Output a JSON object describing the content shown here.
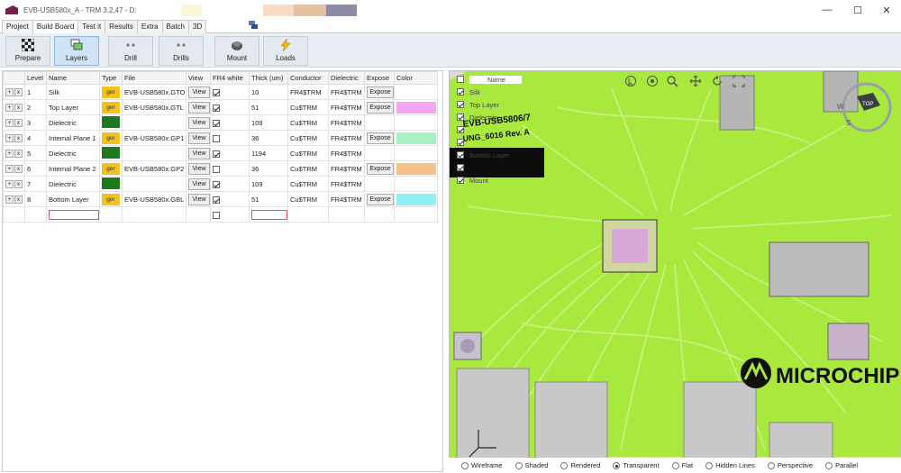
{
  "window": {
    "title": "EVB-USB580x_A - TRM 3.2.47 - D:",
    "minimize_icon": "—",
    "maximize_icon": "☐",
    "close_icon": "✕"
  },
  "tabs": [
    "Project",
    "Build Board",
    "Test it",
    "Results",
    "Extra",
    "Batch",
    "3D"
  ],
  "toolbar": {
    "buttons": [
      {
        "label": "Prepare",
        "icon": "checker-icon"
      },
      {
        "label": "Layers",
        "icon": "layers-icon"
      },
      {
        "label": "Drill",
        "icon": "drill-icon"
      },
      {
        "label": "Drills",
        "icon": "drills-icon"
      },
      {
        "label": "Mount",
        "icon": "mount-icon"
      },
      {
        "label": "Loads",
        "icon": "lightning-icon"
      }
    ]
  },
  "table": {
    "headers": [
      "",
      "Level",
      "Name",
      "Type",
      "File",
      "View",
      "FR4 white",
      "Thick (um)",
      "Conductor",
      "Dielectric",
      "Expose",
      "Color"
    ],
    "view_label": "View",
    "expose_label": "Expose",
    "add_label": "+",
    "remove_label": "x",
    "rows": [
      {
        "level": "1",
        "name": "Silk",
        "type": "ger",
        "type_color": "#f2c21a",
        "file": "EVB-USB580x.GTO",
        "view": true,
        "fr4": true,
        "thick": "10",
        "conductor": "FR4$TRM",
        "dielectric": "FR4$TRM",
        "expose": true,
        "color": ""
      },
      {
        "level": "2",
        "name": "Top Layer",
        "type": "ger",
        "type_color": "#f2c21a",
        "file": "EVB-USB580x.GTL",
        "view": true,
        "fr4": true,
        "thick": "51",
        "conductor": "Cu$TRM",
        "dielectric": "FR4$TRM",
        "expose": true,
        "color": "#f5a6f2"
      },
      {
        "level": "3",
        "name": "Dielectric",
        "type": "",
        "type_color": "#1e7a1e",
        "file": "",
        "view": true,
        "fr4": true,
        "thick": "109",
        "conductor": "Cu$TRM",
        "dielectric": "FR4$TRM",
        "expose": false,
        "color": ""
      },
      {
        "level": "4",
        "name": "Internal Plane 1",
        "type": "ger",
        "type_color": "#f2c21a",
        "file": "EVB-USB580x.GP1",
        "view": true,
        "fr4": false,
        "thick": "36",
        "conductor": "Cu$TRM",
        "dielectric": "FR4$TRM",
        "expose": true,
        "color": "#a8efc4"
      },
      {
        "level": "5",
        "name": "Dielectric",
        "type": "",
        "type_color": "#1e7a1e",
        "file": "",
        "view": true,
        "fr4": true,
        "thick": "1194",
        "conductor": "Cu$TRM",
        "dielectric": "FR4$TRM",
        "expose": false,
        "color": ""
      },
      {
        "level": "6",
        "name": "Internal Plane 2",
        "type": "ger",
        "type_color": "#f2c21a",
        "file": "EVB-USB580x.GP2",
        "view": true,
        "fr4": false,
        "thick": "36",
        "conductor": "Cu$TRM",
        "dielectric": "FR4$TRM",
        "expose": true,
        "color": "#f7c08a"
      },
      {
        "level": "7",
        "name": "Dielectric",
        "type": "",
        "type_color": "#1e7a1e",
        "file": "",
        "view": true,
        "fr4": true,
        "thick": "109",
        "conductor": "Cu$TRM",
        "dielectric": "FR4$TRM",
        "expose": false,
        "color": ""
      },
      {
        "level": "8",
        "name": "Bottom Layer",
        "type": "ger",
        "type_color": "#f2c21a",
        "file": "EVB-USB580x.GBL",
        "view": true,
        "fr4": true,
        "thick": "51",
        "conductor": "Cu$TRM",
        "dielectric": "FR4$TRM",
        "expose": true,
        "color": "#8ff0f5"
      }
    ]
  },
  "viewer": {
    "layer_list_header": "Name",
    "layers": [
      "Silk",
      "Top Layer",
      "Dielectric",
      "",
      "",
      "Bottom Layer",
      "",
      "Mount"
    ],
    "board_labels": {
      "board_name": "EVB-USB5806/7",
      "board_rev": "UNG_6016 Rev. A",
      "brand": "MICROCHIP"
    },
    "cube_label": "TOP",
    "compass": {
      "w": "W",
      "s": "S"
    },
    "render_modes": [
      "Wireframe",
      "Shaded",
      "Rendered",
      "Transparent",
      "Flat",
      "Hidden Lines",
      "Perspective",
      "Parallel"
    ],
    "selected_mode": "Transparent"
  },
  "colors": {
    "pcb": "#a9e83c",
    "trace": "#c9f07a",
    "pad": "#b8b8b8",
    "accent": "#2a6fb6"
  }
}
